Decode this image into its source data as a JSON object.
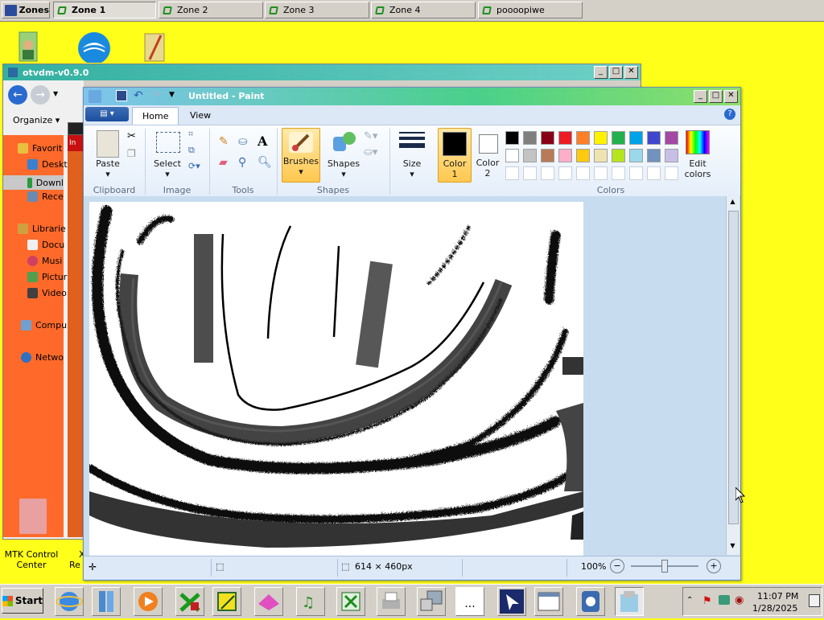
{
  "zones_bar": {
    "title": "Zones",
    "tabs": [
      {
        "label": "Zone 1",
        "active": true
      },
      {
        "label": "Zone 2",
        "active": false
      },
      {
        "label": "Zone 3",
        "active": false
      },
      {
        "label": "Zone 4",
        "active": false
      },
      {
        "label": "poooopiwe",
        "active": false
      }
    ]
  },
  "otvdm_window": {
    "title": "otvdm-v0.9.0",
    "red_strip_text": "In"
  },
  "explorer": {
    "toolbar_organize": "Organize",
    "nav_items": [
      "Favorit",
      "Deskt",
      "Downl",
      "Rece",
      "Librarie",
      "Docu",
      "Musi",
      "Pictur",
      "Video",
      "Compu",
      "Netwo"
    ]
  },
  "desktop": {
    "icon_labels": [
      "MTK Control Center",
      "Re"
    ]
  },
  "paint": {
    "title": "Untitled - Paint",
    "tabs": [
      "Home",
      "View"
    ],
    "ribbon": {
      "paste": "Paste",
      "select": "Select",
      "brushes": "Brushes",
      "shapes": "Shapes",
      "size": "Size",
      "color1": "Color\n1",
      "color2": "Color\n2",
      "edit_colors": "Edit\ncolors",
      "groups": [
        "Clipboard",
        "Image",
        "Tools",
        "Shapes",
        "Colors"
      ]
    },
    "palette_row1": [
      "#000000",
      "#7f7f7f",
      "#880015",
      "#ed1c24",
      "#ff7f27",
      "#fff200",
      "#22b14c",
      "#00a2e8",
      "#3f48cc",
      "#a349a4"
    ],
    "palette_row2": [
      "#ffffff",
      "#c3c3c3",
      "#b97a57",
      "#ffaec9",
      "#ffc90e",
      "#efe4b0",
      "#b5e61d",
      "#99d9ea",
      "#7092be",
      "#c8bfe7"
    ],
    "color1_value": "#000000",
    "color2_value": "#ffffff",
    "status": {
      "dimensions": "614 × 460px",
      "zoom": "100%"
    }
  },
  "taskbar": {
    "start": "Start",
    "clock_time": "11:07 PM",
    "clock_date": "1/28/2025",
    "ellipsis_button": "..."
  }
}
